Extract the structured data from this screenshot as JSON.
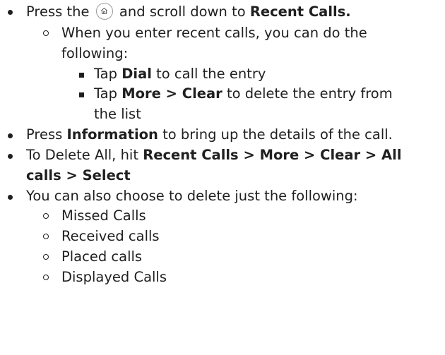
{
  "items": [
    {
      "pre": "Press the ",
      "icon": "home-icon",
      "mid": " and scroll down to ",
      "bold": "Recent Calls."
    },
    {
      "text": "When you enter recent calls, you can do the"
    },
    {
      "text": "following:"
    },
    {
      "pre": "Tap ",
      "bold": "Dial",
      "post": " to call the entry"
    },
    {
      "pre": "Tap ",
      "bold": "More > Clear",
      "post": " to delete the entry from"
    },
    {
      "text": "the list"
    },
    {
      "pre": "Press ",
      "bold": "Information",
      "post": " to bring up the details of the call."
    },
    {
      "pre": "To Delete All, hit ",
      "bold": "Recent Calls > More > Clear > All"
    },
    {
      "bold": "calls > Select"
    },
    {
      "text": "You can also choose to delete just the following:"
    },
    {
      "text": "Missed Calls"
    },
    {
      "text": "Received calls"
    },
    {
      "text": "Placed calls"
    },
    {
      "text": "Displayed Calls"
    }
  ]
}
